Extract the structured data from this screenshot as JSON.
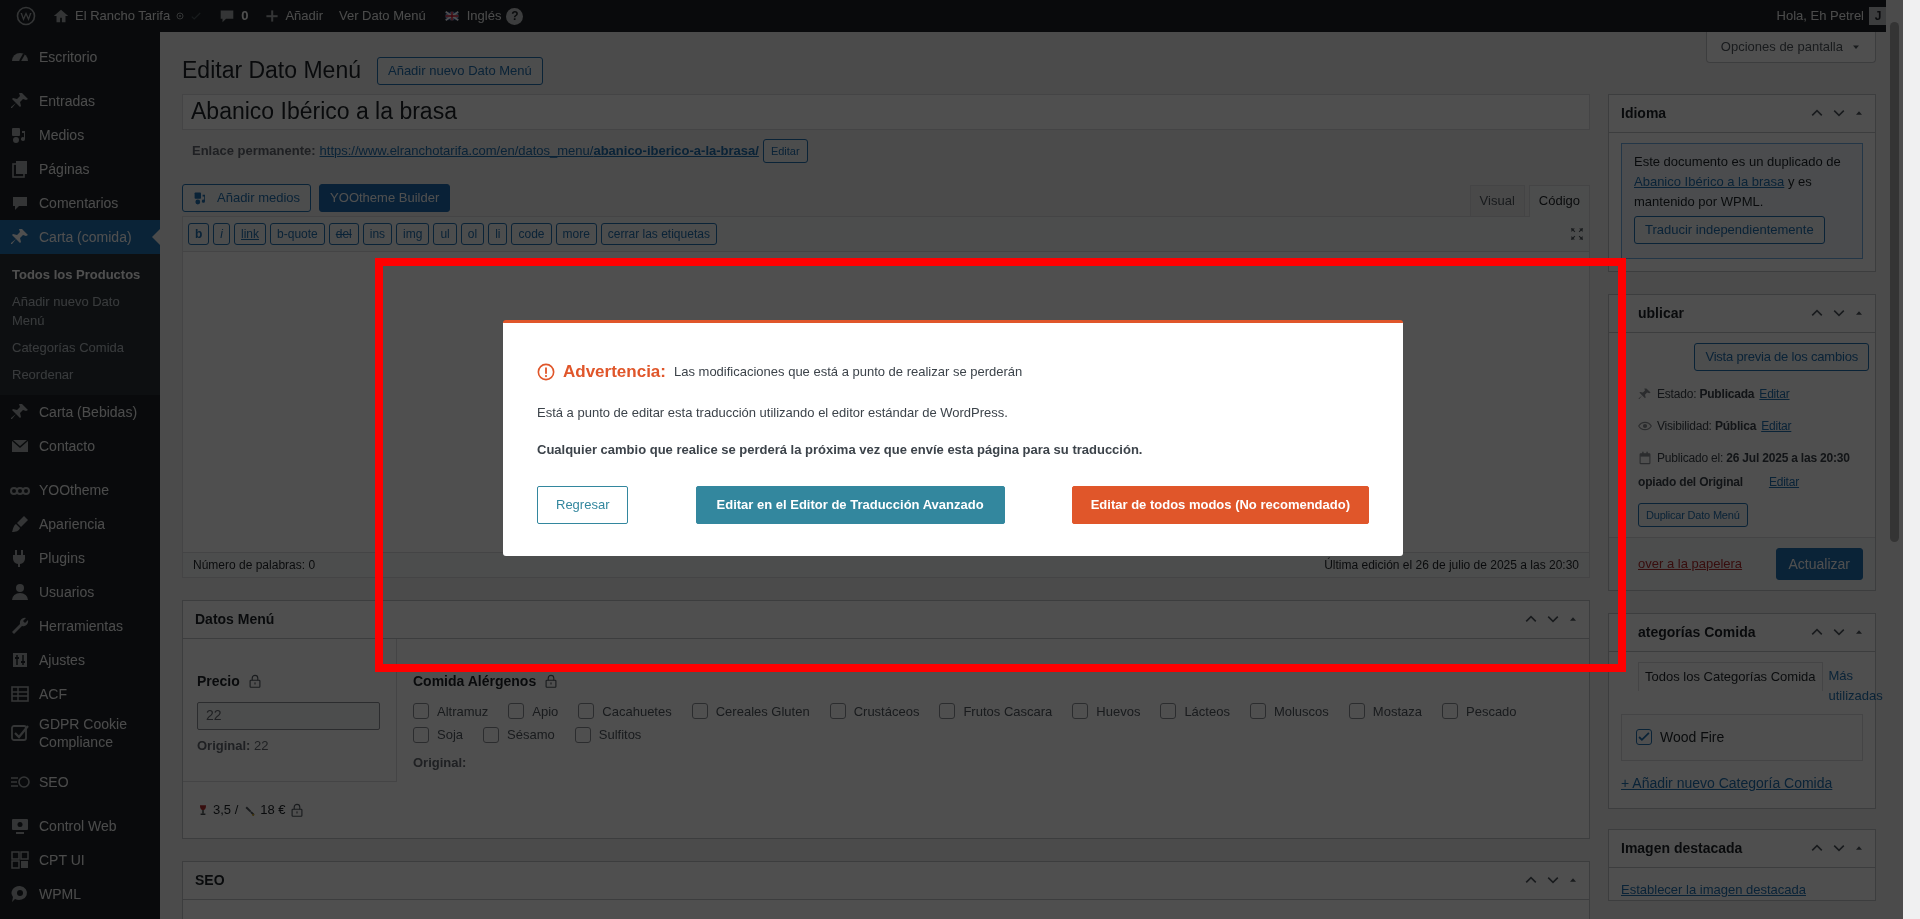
{
  "admin_bar": {
    "site": "El Rancho Tarifa",
    "comments": "0",
    "new": "Añadir",
    "view": "Ver Dato Menú",
    "language": "Inglés",
    "help": "?",
    "greeting": "Hola, Eh Petrel",
    "avatar": "J"
  },
  "sidebar": {
    "groups": [
      {
        "items": [
          {
            "label": "Escritorio",
            "selected": false
          }
        ]
      },
      {
        "items": [
          {
            "label": "Entradas",
            "selected": false
          },
          {
            "label": "Medios",
            "selected": false
          },
          {
            "label": "Páginas",
            "selected": false
          },
          {
            "label": "Comentarios",
            "selected": false
          },
          {
            "label": "Carta (comida)",
            "selected": true,
            "children": [
              {
                "label": "Todos los Productos",
                "selected": true
              },
              {
                "label": "Añadir nuevo Dato Menú",
                "selected": false
              },
              {
                "label": "Categorías Comida",
                "selected": false
              },
              {
                "label": "Reordenar",
                "selected": false
              }
            ]
          },
          {
            "label": "Carta (Bebidas)",
            "selected": false
          },
          {
            "label": "Contacto",
            "selected": false
          }
        ]
      },
      {
        "items": [
          {
            "label": "YOOtheme",
            "selected": false
          },
          {
            "label": "Apariencia",
            "selected": false
          },
          {
            "label": "Plugins",
            "selected": false
          },
          {
            "label": "Usuarios",
            "selected": false
          },
          {
            "label": "Herramientas",
            "selected": false
          },
          {
            "label": "Ajustes",
            "selected": false
          },
          {
            "label": "ACF",
            "selected": false
          },
          {
            "label": "GDPR Cookie Compliance",
            "selected": false
          }
        ]
      },
      {
        "items": [
          {
            "label": "SEO",
            "selected": false
          }
        ]
      },
      {
        "items": [
          {
            "label": "Control Web",
            "selected": false
          },
          {
            "label": "CPT UI",
            "selected": false
          },
          {
            "label": "WPML",
            "selected": false
          }
        ]
      }
    ]
  },
  "screen_options": "Opciones de pantalla",
  "page_title": "Editar Dato Menú",
  "add_new": "Añadir nuevo Dato Menú",
  "post_title": "Abanico Ibérico a la brasa",
  "permalink": {
    "label": "Enlace permanente:",
    "url_base": "https://www.elranchotarifa.com/en/datos_menu/",
    "slug": "abanico-iberico-a-la-brasa/",
    "edit": "Editar"
  },
  "media_buttons": [
    {
      "label": "Añadir medios",
      "kind": "media"
    },
    {
      "label": "YOOtheme Builder",
      "kind": "primary"
    }
  ],
  "editor_tabs": [
    {
      "label": "Visual",
      "selected": false
    },
    {
      "label": "Código",
      "selected": true
    }
  ],
  "quicktags": [
    "b",
    "i",
    "link",
    "b-quote",
    "del",
    "ins",
    "img",
    "ul",
    "ol",
    "li",
    "code",
    "more",
    "cerrar las etiquetas"
  ],
  "word_count": "Número de palabras: 0",
  "last_edit": "Última edición el 26 de julio de 2025 a las 20:30",
  "datos_menu": {
    "title": "Datos Menú",
    "price_label": "Precio",
    "price_value": "22",
    "price_original": "**Original:** 22",
    "allergens_label": "Comida Alérgenos",
    "allergens": [
      {
        "label": "Altramuz",
        "checked": false
      },
      {
        "label": "Apio",
        "checked": false
      },
      {
        "label": "Cacahuetes",
        "checked": false
      },
      {
        "label": "Cereales Gluten",
        "checked": false
      },
      {
        "label": "Crustáceos",
        "checked": false
      },
      {
        "label": "Frutos Cascara",
        "checked": false
      },
      {
        "label": "Huevos",
        "checked": false
      },
      {
        "label": "Lácteos",
        "checked": false
      },
      {
        "label": "Moluscos",
        "checked": false
      },
      {
        "label": "Mostaza",
        "checked": false
      },
      {
        "label": "Pescado",
        "checked": false
      },
      {
        "label": "Soja",
        "checked": false
      },
      {
        "label": "Sésamo",
        "checked": false
      },
      {
        "label": "Sulfitos",
        "checked": false
      }
    ],
    "allergens_original": "Original:",
    "glass_price": "3,5 /",
    "bottle_price": "18 €"
  },
  "seo_box": {
    "title": "SEO"
  },
  "idioma": {
    "title": "Idioma",
    "notice_before": "Este documento es un duplicado de",
    "notice_link": "Abanico Ibérico a la brasa",
    "notice_after": "y es mantenido por WPML.",
    "button": "Traducir independientemente"
  },
  "publicar": {
    "title": "ublicar",
    "preview": "Vista previa de los cambios",
    "rows": [
      {
        "label": "Estado:",
        "value": "Publicada",
        "edit": "Editar"
      },
      {
        "label": "Visibilidad:",
        "value": "Pública",
        "edit": "Editar"
      },
      {
        "label": "Publicado el:",
        "value": "26 Jul 2025 a las 20:30"
      }
    ],
    "copied": "opiado del Original",
    "copied_edit": "Editar",
    "duplicate": "Duplicar Dato Menú",
    "trash": "over a la papelera",
    "update": "Actualizar"
  },
  "categorias": {
    "title": "ategorías Comida",
    "tabs": [
      {
        "label": "Todos los Categorías Comida",
        "selected": true
      },
      {
        "label": "Más utilizadas",
        "selected": false
      }
    ],
    "items": [
      {
        "label": "Wood Fire",
        "checked": true
      }
    ],
    "add": "+ Añadir nuevo Categoría Comida"
  },
  "imagen": {
    "title": "Imagen destacada",
    "link": "Establecer la imagen destacada"
  },
  "modal": {
    "warning_label": "Advertencia:",
    "warning_text": "Las modificaciones que está a punto de realizar se perderán",
    "line1": "Está a punto de editar esta traducción utilizando el editor estándar de WordPress.",
    "line2": "Cualquier cambio que realice se perderá la próxima vez que envíe esta página para su traducción.",
    "buttons": [
      {
        "label": "Regresar",
        "kind": "outline"
      },
      {
        "label": "Editar en el Editor de Traducción Avanzado",
        "kind": "primary"
      },
      {
        "label": "Editar de todos modos (No recomendado)",
        "kind": "danger"
      }
    ]
  }
}
